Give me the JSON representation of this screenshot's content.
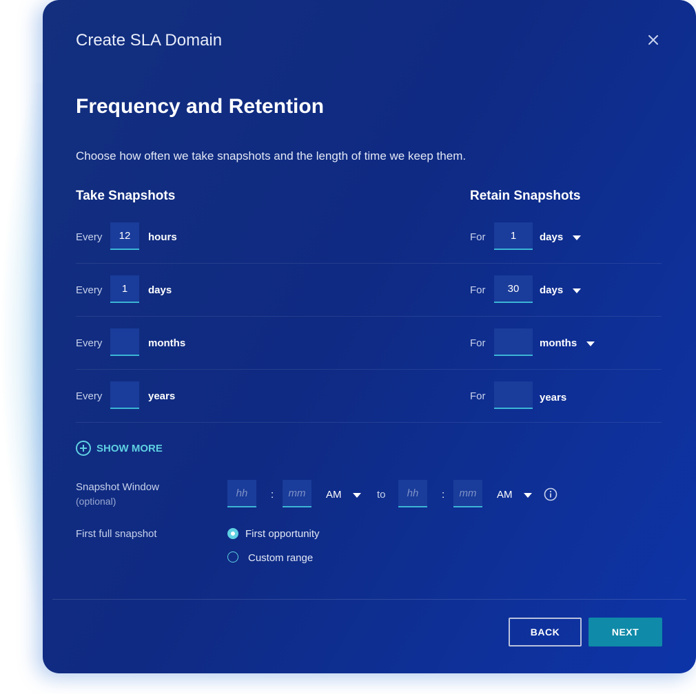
{
  "dialog": {
    "title": "Create SLA Domain",
    "heading": "Frequency and Retention",
    "description": "Choose how often we take snapshots and the length of time we keep them."
  },
  "take": {
    "header": "Take Snapshots",
    "label": "Every",
    "rows": [
      {
        "value": "12",
        "unit": "hours"
      },
      {
        "value": "1",
        "unit": "days"
      },
      {
        "value": "",
        "unit": "months"
      },
      {
        "value": "",
        "unit": "years"
      }
    ]
  },
  "retain": {
    "header": "Retain Snapshots",
    "label": "For",
    "rows": [
      {
        "value": "1",
        "unit": "days"
      },
      {
        "value": "30",
        "unit": "days"
      },
      {
        "value": "",
        "unit": "months"
      },
      {
        "value": "",
        "unit": "years"
      }
    ]
  },
  "show_more": "SHOW MORE",
  "window": {
    "label": "Snapshot Window",
    "sublabel": "(optional)",
    "hh_placeholder": "hh",
    "mm_placeholder": "mm",
    "colon": ":",
    "to": "to",
    "start_ampm": "AM",
    "end_ampm": "AM"
  },
  "first_full": {
    "label": "First full snapshot",
    "options": [
      "First opportunity",
      "Custom range"
    ],
    "selected": "First opportunity"
  },
  "buttons": {
    "back": "BACK",
    "next": "NEXT"
  },
  "colors": {
    "accent": "#5fd0e2",
    "primary": "#0f8aa8",
    "background": "#0f2a82"
  }
}
